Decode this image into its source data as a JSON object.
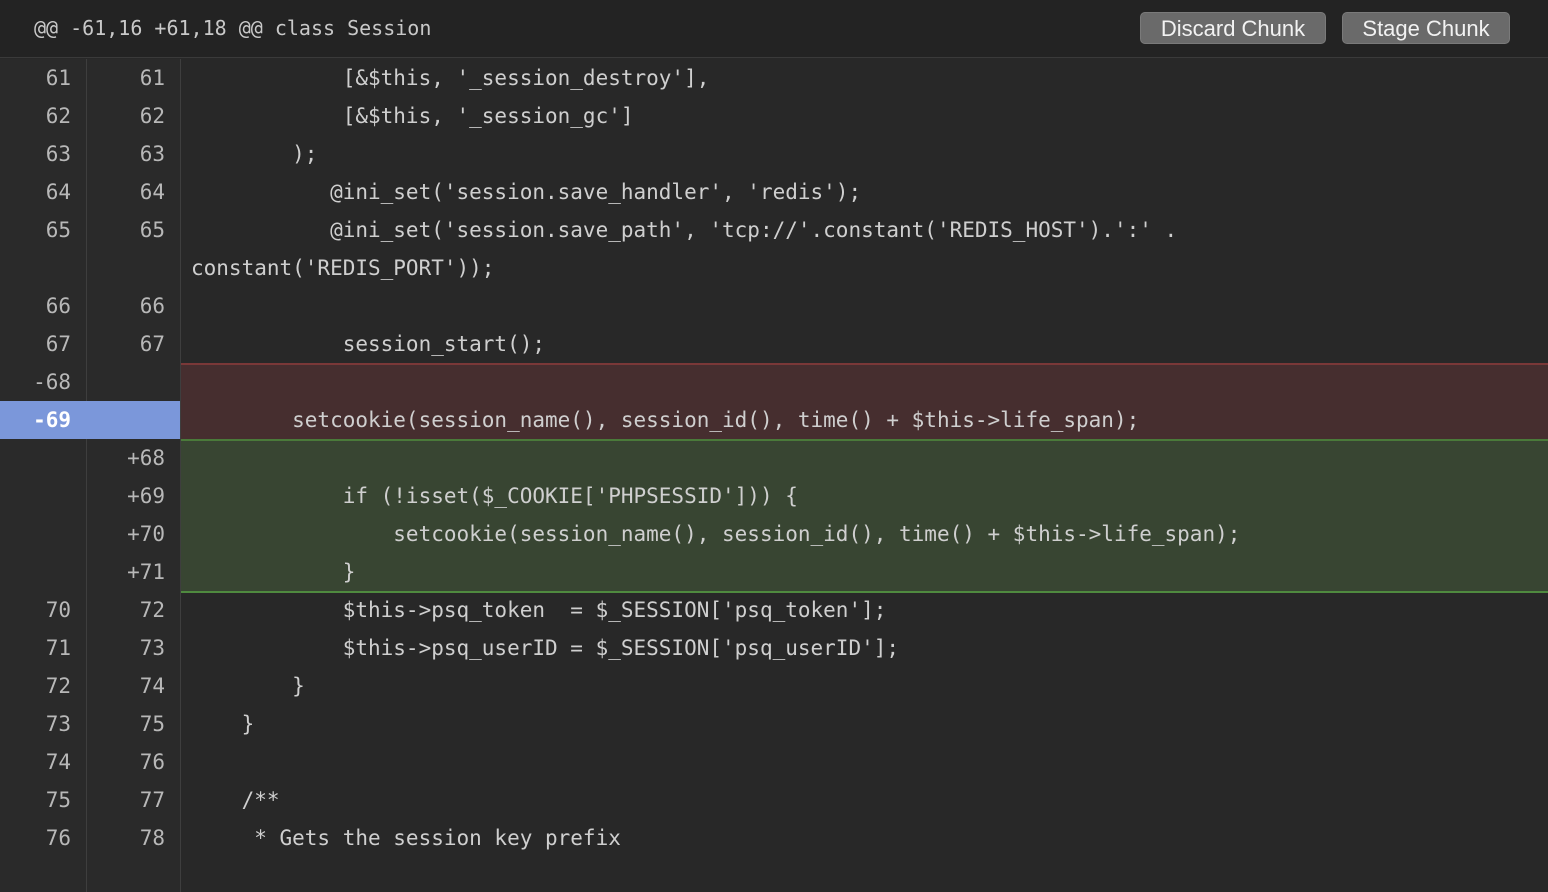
{
  "header": {
    "hunk": "@@ -61,16 +61,18 @@ class Session",
    "discard_label": "Discard Chunk",
    "stage_label": "Stage Chunk"
  },
  "colors": {
    "removed_bg": "#462e2f",
    "added_bg": "#384532",
    "selected_gutter": "#7b97da",
    "button_bg": "#6a6a6a"
  },
  "lines": [
    {
      "old": "61",
      "new": "61",
      "type": "context",
      "text": "            [&$this, '_session_destroy'],"
    },
    {
      "old": "62",
      "new": "62",
      "type": "context",
      "text": "            [&$this, '_session_gc']"
    },
    {
      "old": "63",
      "new": "63",
      "type": "context",
      "text": "        );"
    },
    {
      "old": "64",
      "new": "64",
      "type": "context",
      "text": "           @ini_set('session.save_handler', 'redis');"
    },
    {
      "old": "65",
      "new": "65",
      "type": "context",
      "text": "           @ini_set('session.save_path', 'tcp://'.constant('REDIS_HOST').':' ."
    },
    {
      "old": "",
      "new": "",
      "type": "cont",
      "text": "constant('REDIS_PORT'));"
    },
    {
      "old": "66",
      "new": "66",
      "type": "context",
      "text": ""
    },
    {
      "old": "67",
      "new": "67",
      "type": "context",
      "text": "            session_start();"
    },
    {
      "old": "-68",
      "new": "",
      "type": "removed",
      "text": ""
    },
    {
      "old": "-69",
      "new": "",
      "type": "removed selected",
      "text": "        setcookie(session_name(), session_id(), time() + $this->life_span);"
    },
    {
      "old": "",
      "new": "+68",
      "type": "added",
      "text": ""
    },
    {
      "old": "",
      "new": "+69",
      "type": "added",
      "text": "            if (!isset($_COOKIE['PHPSESSID'])) {"
    },
    {
      "old": "",
      "new": "+70",
      "type": "added",
      "text": "                setcookie(session_name(), session_id(), time() + $this->life_span);"
    },
    {
      "old": "",
      "new": "+71",
      "type": "added",
      "text": "            }"
    },
    {
      "old": "70",
      "new": "72",
      "type": "context",
      "text": "            $this->psq_token  = $_SESSION['psq_token'];"
    },
    {
      "old": "71",
      "new": "73",
      "type": "context",
      "text": "            $this->psq_userID = $_SESSION['psq_userID'];"
    },
    {
      "old": "72",
      "new": "74",
      "type": "context",
      "text": "        }"
    },
    {
      "old": "73",
      "new": "75",
      "type": "context",
      "text": "    }"
    },
    {
      "old": "74",
      "new": "76",
      "type": "context",
      "text": ""
    },
    {
      "old": "75",
      "new": "77",
      "type": "context",
      "text": "    /**"
    },
    {
      "old": "76",
      "new": "78",
      "type": "context",
      "text": "     * Gets the session key prefix"
    }
  ]
}
